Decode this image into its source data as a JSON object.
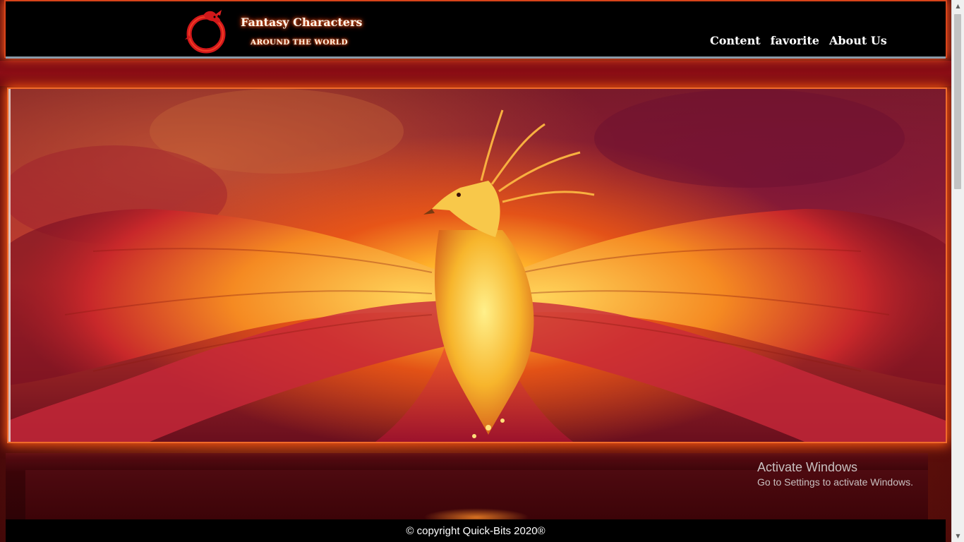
{
  "header": {
    "brand_title": "Fantasy Characters",
    "brand_subtitle": "AROUND THE WORLD",
    "logo_icon": "dragon-ouroboros-icon",
    "nav": [
      {
        "label": "Content"
      },
      {
        "label": "favorite"
      },
      {
        "label": "About Us"
      }
    ]
  },
  "hero": {
    "image": "phoenix-firebird-banner"
  },
  "watermark": {
    "title": "Activate Windows",
    "subtitle": "Go to Settings to activate Windows."
  },
  "footer": {
    "copyright": "© copyright Quick-Bits 2020®"
  },
  "colors": {
    "accent_orange": "#ff5a1f",
    "deep_red": "#5a0a10",
    "header_bg": "#000000"
  }
}
